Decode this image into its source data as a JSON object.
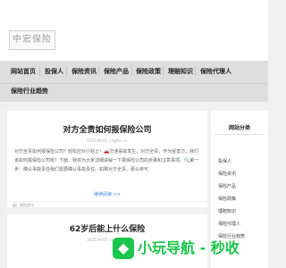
{
  "header": {
    "logo_text": "中宏保险"
  },
  "nav": {
    "items": [
      {
        "label": "网站首页"
      },
      {
        "label": "投保人"
      },
      {
        "label": "保险资讯"
      },
      {
        "label": "保险产品"
      },
      {
        "label": "保险政策"
      },
      {
        "label": "理赔知识"
      },
      {
        "label": "保险代理人"
      },
      {
        "label": "保险行业趋势"
      }
    ]
  },
  "posts": [
    {
      "title": "对方全责如何报保险公司",
      "meta": "2025.09.07 / zqjthn.cn",
      "excerpt": "对方全责如何报保险公司？轻松应对小贴士！🚗交通事故发生，对方全责，作为受害方，我们该如何报保险公司呢？下面，我将为大家详细讲解一下报保险公司的步骤和注意事项。🔍第一步：确认事故责任我们需要确认事故责任。如果对方全责，那么恭可",
      "readmore": "继续阅读 >>",
      "tag_label": "保险资讯"
    },
    {
      "title": "62岁后能上什么保险",
      "meta": "2025.09.07 / zqjthn.cn"
    }
  ],
  "sidebar": {
    "title": "网站分类",
    "items": [
      {
        "label": "投保人"
      },
      {
        "label": "保险资讯"
      },
      {
        "label": "保险产品"
      },
      {
        "label": "保险政策"
      },
      {
        "label": "理赔知识"
      },
      {
        "label": "保险代理人"
      },
      {
        "label": "保险行业趋势"
      }
    ]
  },
  "watermark": {
    "icon": "◆",
    "text": "小玩导航 - 秒收"
  },
  "colors": {
    "accent": "#3b86d9",
    "watermark": "#19c54a",
    "nav_bg": "#dedede",
    "page_bg": "#f1f1f1"
  }
}
